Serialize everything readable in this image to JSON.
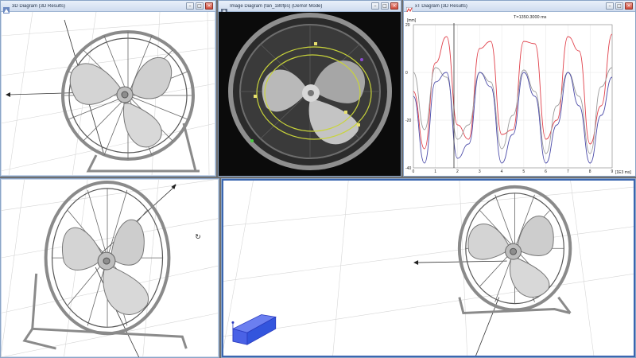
{
  "windows": {
    "top_left": {
      "title": "3D Diagram (3D Results)"
    },
    "top_middle": {
      "title": "Image Diagram (fan_180fps) (Demo! Mode)"
    },
    "top_right": {
      "title": "xT Diagram (3D Results)"
    },
    "bottom_left": {
      "title": ""
    },
    "bottom_right": {
      "title": ""
    }
  },
  "chart": {
    "time_readout": "T=1350.3000 ms",
    "y_unit": "[mm]",
    "x_unit": "[1E3 ms]",
    "y_ticks": [
      "20",
      "0",
      "-20",
      "-40"
    ],
    "x_ticks": [
      "0",
      "1",
      "2",
      "3",
      "4",
      "5",
      "6",
      "7",
      "8",
      "9"
    ]
  },
  "chart_data": {
    "type": "line",
    "title": "",
    "xlabel": "[1E3 ms]",
    "ylabel": "[mm]",
    "xlim": [
      0,
      9
    ],
    "ylim": [
      -40,
      20
    ],
    "x": [
      0,
      0.5,
      1,
      1.5,
      2,
      2.5,
      3,
      3.5,
      4,
      4.5,
      5,
      5.5,
      6,
      6.5,
      7,
      7.5,
      8,
      8.5,
      9
    ],
    "series": [
      {
        "color": "#e0404a",
        "values": [
          -8,
          -32,
          4,
          15,
          -22,
          -28,
          10,
          13,
          -26,
          -24,
          13,
          12,
          -28,
          -20,
          15,
          9,
          -30,
          -14,
          16
        ]
      },
      {
        "color": "#9a9a9a",
        "values": [
          0,
          -24,
          2,
          -2,
          -28,
          -22,
          0,
          -4,
          -32,
          -18,
          1,
          -8,
          -34,
          -14,
          0,
          -10,
          -34,
          -6,
          2
        ]
      },
      {
        "color": "#4a4aa8",
        "values": [
          -10,
          -38,
          -4,
          0,
          -36,
          -30,
          0,
          -6,
          -38,
          -26,
          0,
          -10,
          -38,
          -22,
          0,
          -14,
          -38,
          -18,
          -2
        ]
      }
    ]
  },
  "colors": {
    "title_gradient_top": "#e9f0fa",
    "active_border": "#3a66b0",
    "tracking_circle": "#c9d43a",
    "box_blue": "#3355dd"
  },
  "icons": {
    "window_controls": [
      "minimize-icon",
      "maximize-icon",
      "close-icon"
    ],
    "cursor": "rotate-cursor-icon"
  }
}
